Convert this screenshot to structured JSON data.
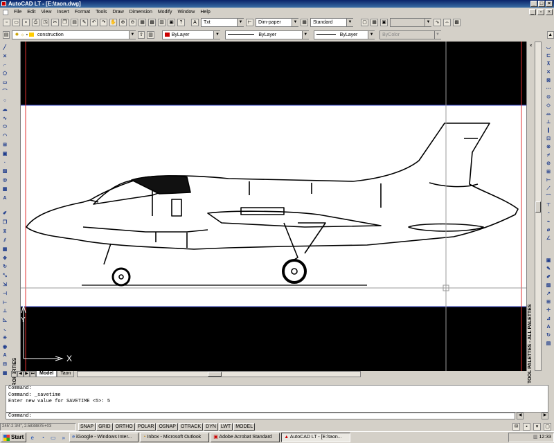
{
  "window": {
    "title": "AutoCAD LT - [E:\\taon.dwg]"
  },
  "menu": [
    "File",
    "Edit",
    "View",
    "Insert",
    "Format",
    "Tools",
    "Draw",
    "Dimension",
    "Modify",
    "Window",
    "Help"
  ],
  "styles": {
    "text_style": "Txt",
    "dim_style": "Dim-paper",
    "table_style": "Standard"
  },
  "layers": {
    "current": "construction"
  },
  "properties": {
    "color": "ByLayer",
    "linetype": "ByLayer",
    "lineweight": "ByLayer",
    "plot_style": "ByColor"
  },
  "side_labels": {
    "properties": "PROPERTIES",
    "tool_palettes": "TOOL PALETTES - ALL PALETTES"
  },
  "ucs": {
    "x_label": "X",
    "y_label": "Y"
  },
  "layout_tabs": [
    "Model",
    "Taon"
  ],
  "command_history": [
    "Command:",
    "Command: _savetime",
    "Enter new value for SAVETIME <5>: 5"
  ],
  "command_prompt": "Command:",
  "status": {
    "coordinates": "245'-2 3/4\", 2.583887E+03",
    "toggles": [
      "SNAP",
      "GRID",
      "ORTHO",
      "POLAR",
      "OSNAP",
      "OTRACK",
      "DYN",
      "LWT",
      "MODEL"
    ]
  },
  "taskbar": {
    "start": "Start",
    "tasks": [
      "iGoogle - Windows Inter...",
      "Inbox - Microsoft Outlook",
      "Adobe Acrobat Standard",
      "AutoCAD LT - [E:\\taon..."
    ],
    "clock": "12:33"
  },
  "colors": {
    "titlebar": "#0a246a",
    "canvas": "#000000",
    "image_bg": "#ffffff",
    "layer_swatch": "#ffcc00",
    "color_swatch": "#cc0000"
  }
}
